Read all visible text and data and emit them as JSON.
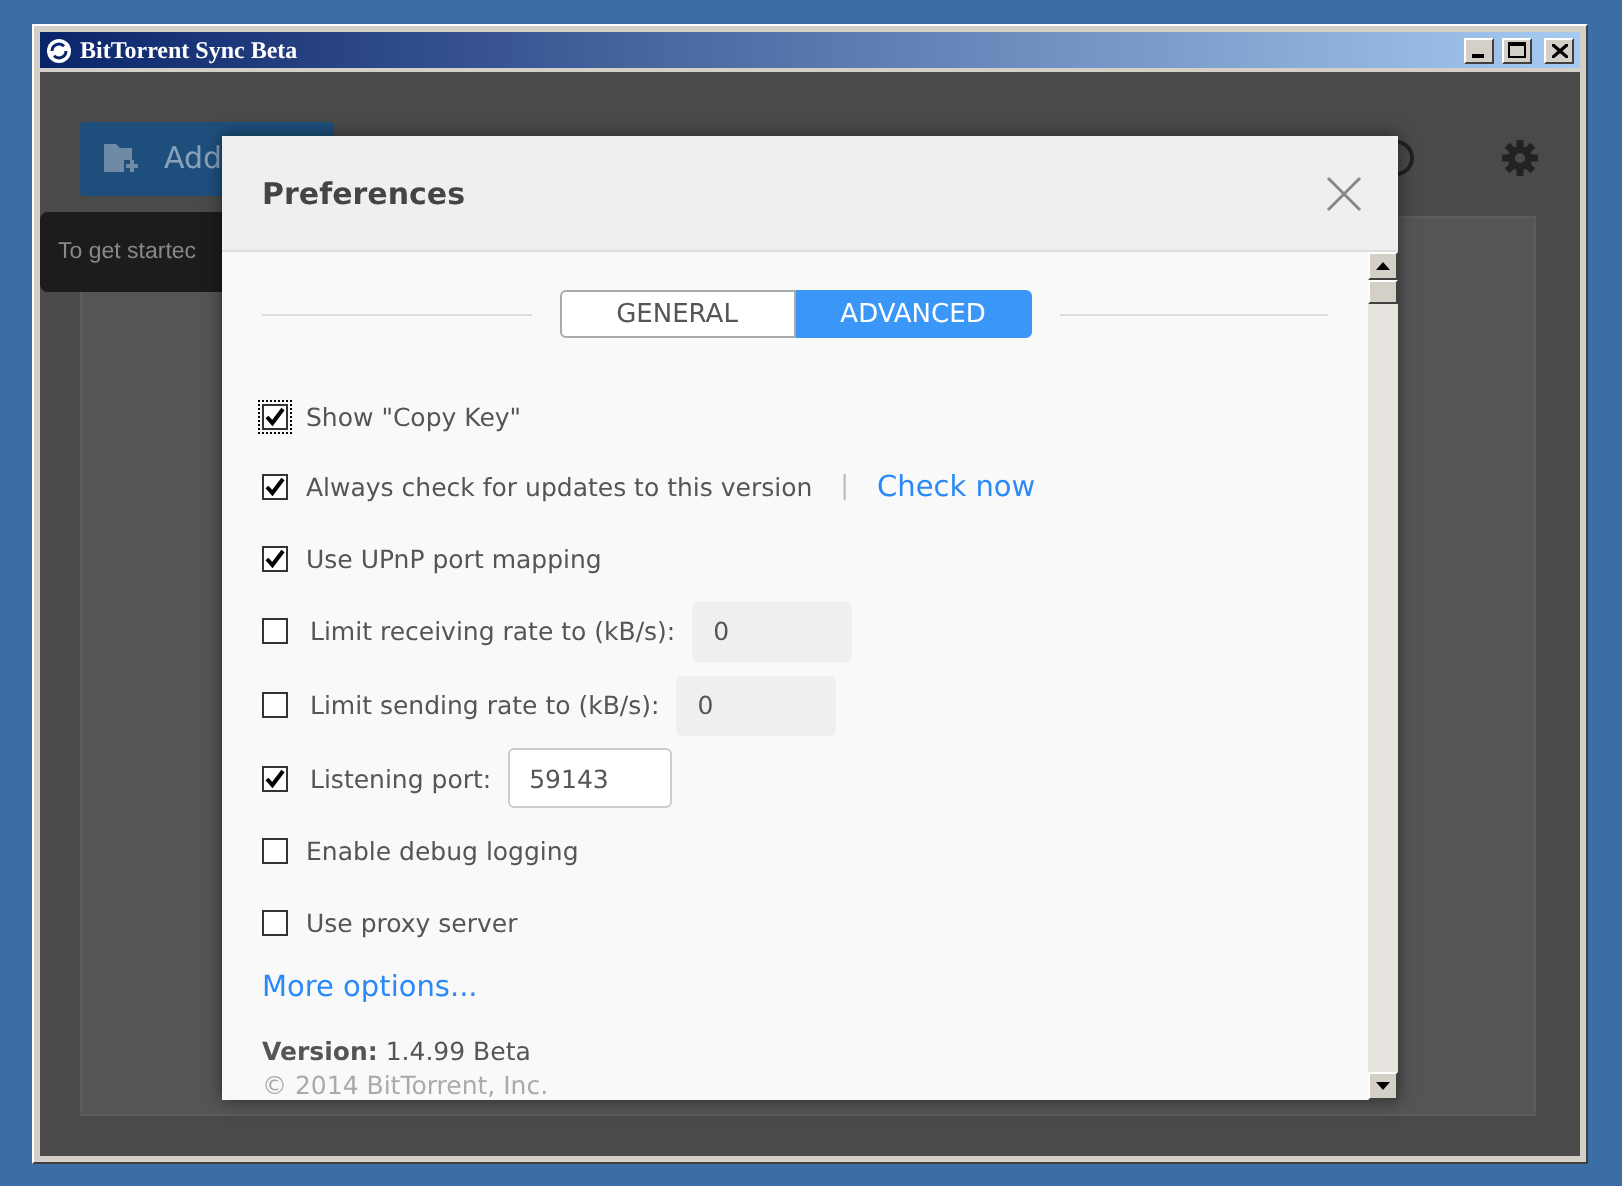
{
  "window": {
    "title": "BitTorrent Sync Beta"
  },
  "background": {
    "add_button": "Add",
    "tooltip": "To get startec"
  },
  "dialog": {
    "title": "Preferences",
    "tabs": [
      {
        "label": "GENERAL",
        "selected": false
      },
      {
        "label": "ADVANCED",
        "selected": true
      }
    ],
    "options": [
      {
        "kind": "checkbox",
        "label": "Show \"Copy Key\"",
        "checked": true,
        "focused": true
      },
      {
        "kind": "link",
        "label": "Always check for updates to this version",
        "checked": true,
        "separator": "|",
        "link": "Check now"
      },
      {
        "kind": "checkbox",
        "label": "Use UPnP port mapping",
        "checked": true
      },
      {
        "kind": "input",
        "label": "Limit receiving rate to (kB/s):",
        "checked": false,
        "value": "0"
      },
      {
        "kind": "input",
        "label": "Limit sending rate to (kB/s):",
        "checked": false,
        "value": "0"
      },
      {
        "kind": "input",
        "label": "Listening port:",
        "checked": true,
        "value": "59143"
      },
      {
        "kind": "checkbox",
        "label": "Enable debug logging",
        "checked": false
      },
      {
        "kind": "checkbox",
        "label": "Use proxy server",
        "checked": false
      }
    ],
    "more_link": "More options...",
    "version": "**Version:** 1.4.99 Beta",
    "copyright": "© 2014 BitTorrent, Inc."
  }
}
